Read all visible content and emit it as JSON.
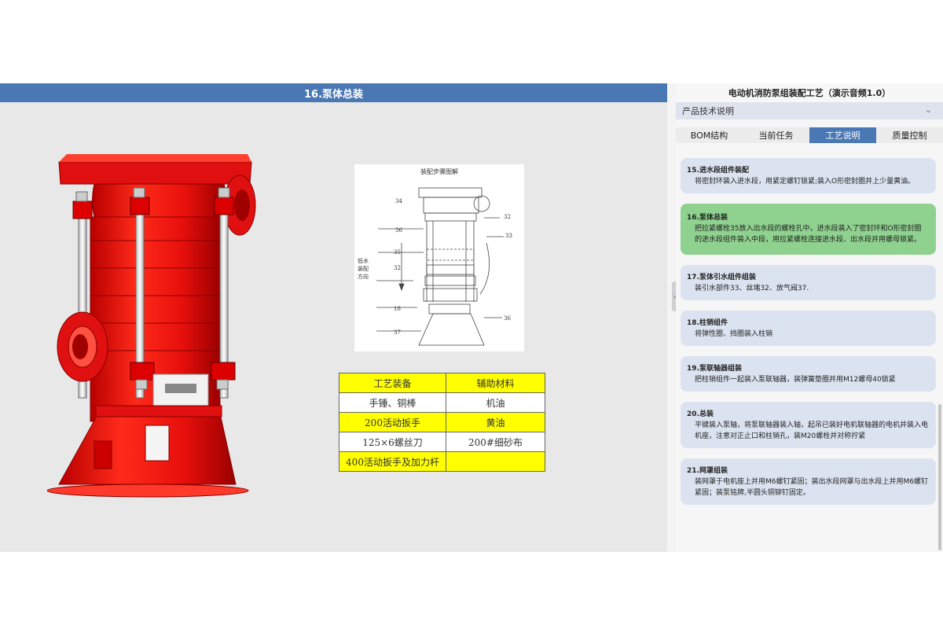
{
  "main": {
    "title": "16.泵体总装",
    "diagram_title": "装配步骤图解",
    "diagram_labels": [
      "34",
      "32",
      "36",
      "33",
      "35",
      "32",
      "18",
      "37",
      "36"
    ],
    "diagram_side_text": [
      "低水",
      "装配",
      "方向"
    ],
    "tools": {
      "headers": [
        "工艺装备",
        "辅助材料"
      ],
      "rows": [
        [
          "手锤、铜棒",
          "机油"
        ],
        [
          "200活动扳手",
          "黄油"
        ],
        [
          "125×6螺丝刀",
          "200#细砂布"
        ],
        [
          "400活动扳手及加力杆",
          ""
        ]
      ]
    }
  },
  "side": {
    "title": "电动机消防泵组装配工艺（演示音频1.0）",
    "subtitle": "产品技术说明",
    "tabs": [
      "BOM结构",
      "当前任务",
      "工艺说明",
      "质量控制"
    ],
    "active_tab": 2,
    "steps": [
      {
        "title": "15.进水段组件装配",
        "desc": "将密封环装入进水段，用紧定螺钉锁紧;装入O形密封圈并上少量黄油。"
      },
      {
        "title": "16.泵体总装",
        "desc": "把拉紧螺栓35放入出水段的螺栓孔中，进水段装入了密封环和O形密封圈的进水段组件装入中段，用拉紧螺栓连接进水段、出水段并用螺母锁紧。"
      },
      {
        "title": "17.泵体引水组件组装",
        "desc": "装引水部件33、丝堵32、放气阀37."
      },
      {
        "title": "18.柱销组件",
        "desc": "将弹性圈、挡圈装入柱销"
      },
      {
        "title": "19.泵联轴器组装",
        "desc": "把柱销组件一起装入泵联轴器，装弹簧垫圈并用M12螺母40锁紧"
      },
      {
        "title": "20.总装",
        "desc": "平键装入泵轴，将泵联轴器装入轴，起吊已装好电机联轴器的电机并装入电机座，注意对正止口和柱销孔，装M20螺栓并对称拧紧"
      },
      {
        "title": "21.网罩组装",
        "desc": "装网罩于电机座上并用M6螺钉紧固；装出水段网罩与出水段上并用M6螺钉紧固；装泵铭牌,半圆头铜铆钉固定。"
      }
    ]
  },
  "colors": {
    "header_blue": "#4a78b5",
    "pump_red": "#e8100c",
    "active_step": "#8fd18f",
    "step_bg": "#dce3f0",
    "table_yellow": "#ffff00"
  }
}
